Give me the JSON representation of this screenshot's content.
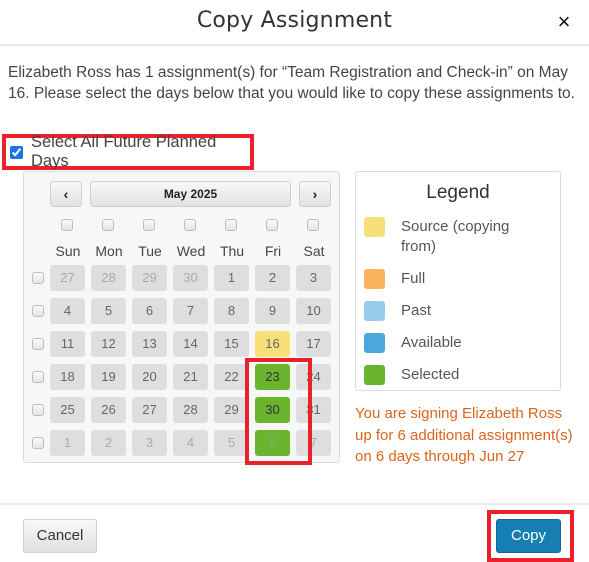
{
  "dialog": {
    "title": "Copy Assignment",
    "close_icon": "×"
  },
  "description": "Elizabeth Ross has 1 assignment(s) for “Team Registration and Check-in” on May 16. Please select the days below that you would like to copy these assignments to.",
  "select_all": {
    "label": "Select All Future Planned Days",
    "checked": true
  },
  "calendar": {
    "prev_label": "‹",
    "next_label": "›",
    "month_label": "May 2025",
    "weekdays": [
      "Sun",
      "Mon",
      "Tue",
      "Wed",
      "Thu",
      "Fri",
      "Sat"
    ],
    "weeks": [
      [
        {
          "d": "27",
          "s": "muted"
        },
        {
          "d": "28",
          "s": "muted"
        },
        {
          "d": "29",
          "s": "muted"
        },
        {
          "d": "30",
          "s": "muted"
        },
        {
          "d": "1",
          "s": ""
        },
        {
          "d": "2",
          "s": ""
        },
        {
          "d": "3",
          "s": ""
        }
      ],
      [
        {
          "d": "4",
          "s": ""
        },
        {
          "d": "5",
          "s": ""
        },
        {
          "d": "6",
          "s": ""
        },
        {
          "d": "7",
          "s": ""
        },
        {
          "d": "8",
          "s": ""
        },
        {
          "d": "9",
          "s": ""
        },
        {
          "d": "10",
          "s": ""
        }
      ],
      [
        {
          "d": "11",
          "s": ""
        },
        {
          "d": "12",
          "s": ""
        },
        {
          "d": "13",
          "s": ""
        },
        {
          "d": "14",
          "s": ""
        },
        {
          "d": "15",
          "s": ""
        },
        {
          "d": "16",
          "s": "source"
        },
        {
          "d": "17",
          "s": ""
        }
      ],
      [
        {
          "d": "18",
          "s": ""
        },
        {
          "d": "19",
          "s": ""
        },
        {
          "d": "20",
          "s": ""
        },
        {
          "d": "21",
          "s": ""
        },
        {
          "d": "22",
          "s": ""
        },
        {
          "d": "23",
          "s": "selected"
        },
        {
          "d": "24",
          "s": ""
        }
      ],
      [
        {
          "d": "25",
          "s": ""
        },
        {
          "d": "26",
          "s": ""
        },
        {
          "d": "27",
          "s": ""
        },
        {
          "d": "28",
          "s": ""
        },
        {
          "d": "29",
          "s": ""
        },
        {
          "d": "30",
          "s": "selected"
        },
        {
          "d": "31",
          "s": ""
        }
      ],
      [
        {
          "d": "1",
          "s": "muted"
        },
        {
          "d": "2",
          "s": "muted"
        },
        {
          "d": "3",
          "s": "muted"
        },
        {
          "d": "4",
          "s": "muted"
        },
        {
          "d": "5",
          "s": "muted"
        },
        {
          "d": "6",
          "s": "selected muted"
        },
        {
          "d": "7",
          "s": "muted"
        }
      ]
    ]
  },
  "legend": {
    "title": "Legend",
    "items": [
      {
        "label": "Source (copying from)",
        "color": "#f8df78"
      },
      {
        "label": "Full",
        "color": "#fbb25e"
      },
      {
        "label": "Past",
        "color": "#97cdea"
      },
      {
        "label": "Available",
        "color": "#4aa8da"
      },
      {
        "label": "Selected",
        "color": "#6bb52e"
      }
    ]
  },
  "notice": "You are signing Elizabeth Ross up for 6 additional assignment(s) on 6 days through Jun 27",
  "footer": {
    "cancel_label": "Cancel",
    "copy_label": "Copy"
  }
}
